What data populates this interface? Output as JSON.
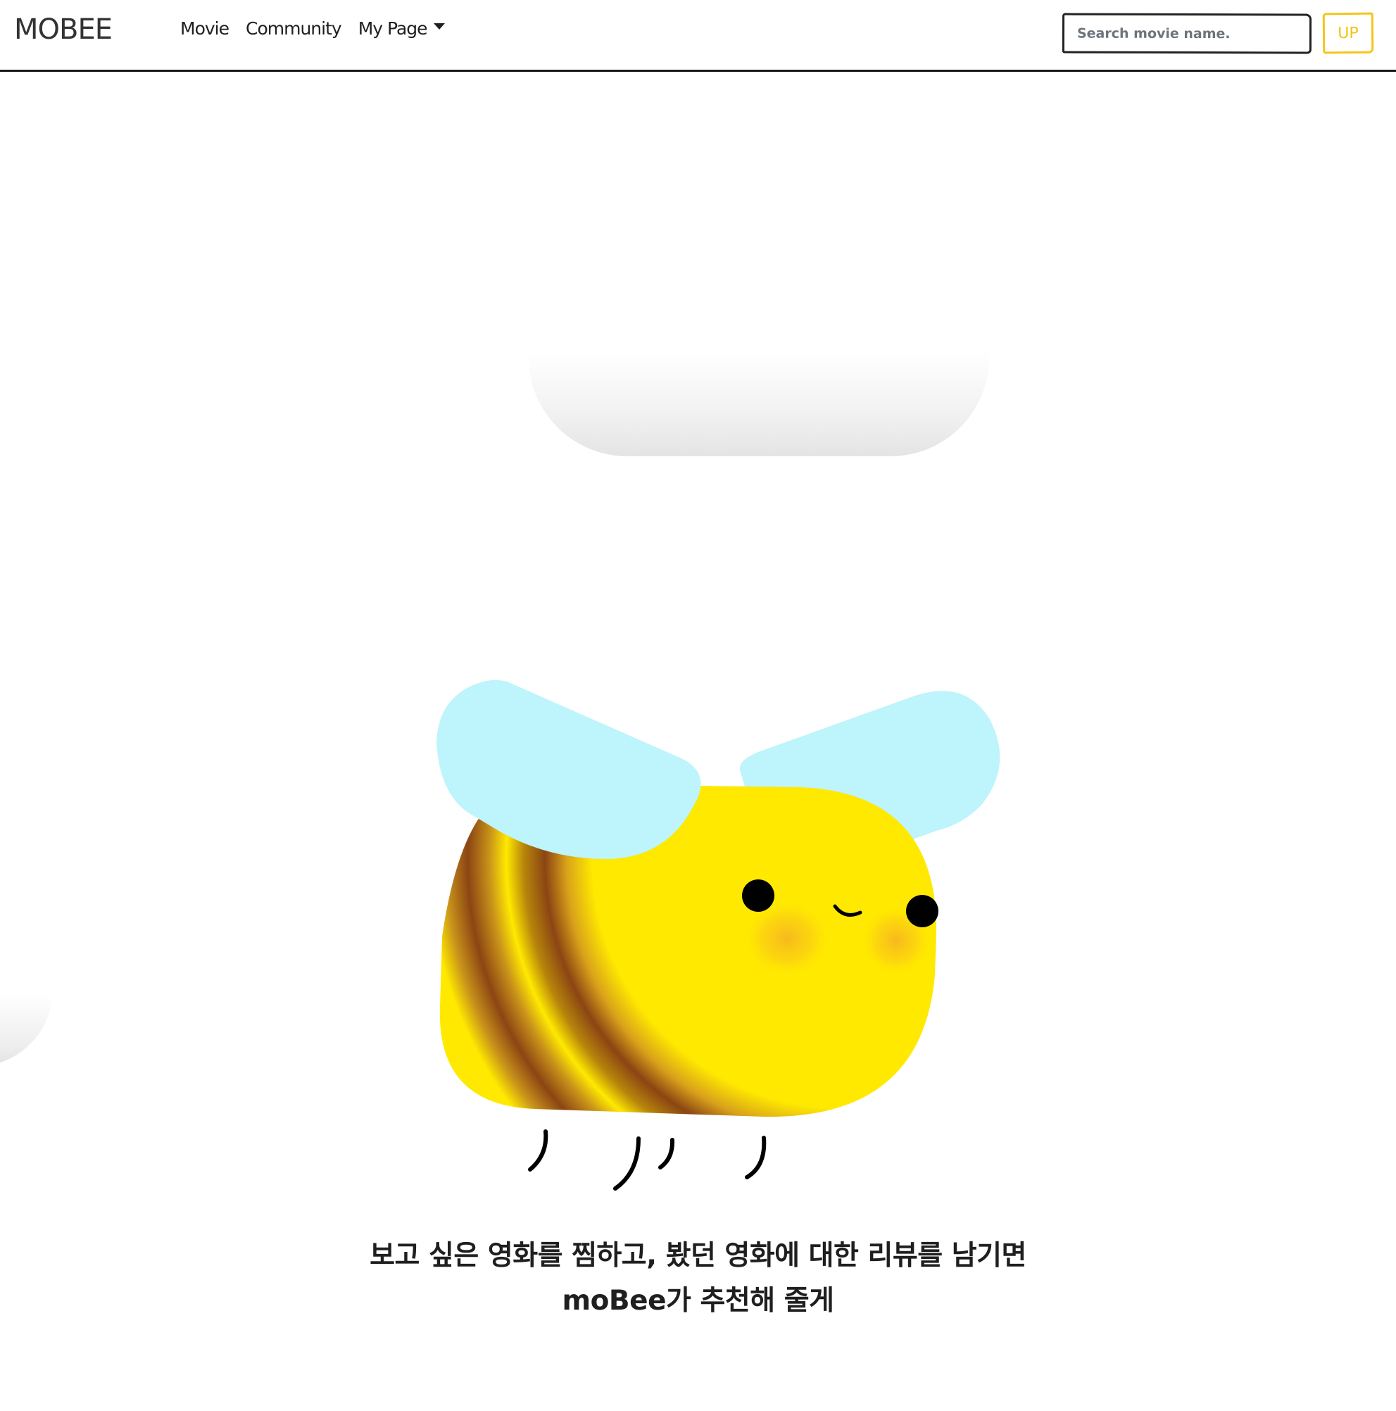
{
  "navbar": {
    "brand": "MOBEE",
    "links": [
      {
        "label": "Movie"
      },
      {
        "label": "Community"
      },
      {
        "label": "My Page"
      }
    ],
    "search": {
      "placeholder": "Search movie name.",
      "value": "",
      "button_label": "UP"
    }
  },
  "hero": {
    "mascot": "bee-mascot",
    "message_lines": [
      "보고 싶은 영화를 찜하고, 봤던 영화에 대한 리뷰를 남기면",
      "moBee가 추천해 줄게"
    ]
  },
  "colors": {
    "bee_body": "#FFE900",
    "bee_stripe": "#8B4513",
    "bee_wing": "#BEF4FB",
    "bee_cheek": "#F7B61F",
    "accent": "#F5C518",
    "text": "#1F1F1F"
  }
}
